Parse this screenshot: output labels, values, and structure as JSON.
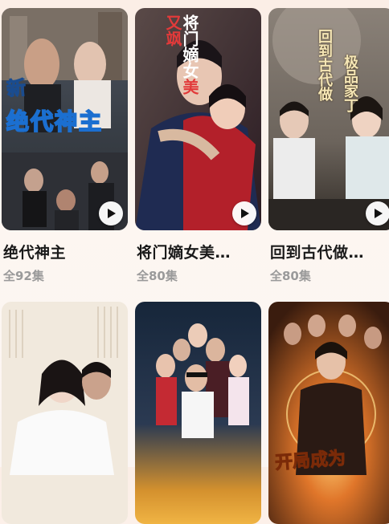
{
  "dramas": [
    {
      "title": "绝代神主",
      "episodes": "全92集",
      "poster_text_line1": "新",
      "poster_text_line2": "绝代神主",
      "poster_palette": [
        "#2b3542",
        "#5c6a7a",
        "#2f8fe0"
      ]
    },
    {
      "title": "将门嫡女美…",
      "episodes": "全80集",
      "poster_text_line1": "将门嫡女",
      "poster_text_line2": "美又飒",
      "poster_palette": [
        "#3a2530",
        "#b0212a",
        "#1f2f5a"
      ]
    },
    {
      "title": "回到古代做…",
      "episodes": "全80集",
      "poster_text_line1": "回到古代做",
      "poster_text_line2": "极品家丁",
      "poster_palette": [
        "#7d7368",
        "#d6cfc4",
        "#4a3c2c"
      ]
    },
    {
      "title": "",
      "episodes": "",
      "poster_palette": [
        "#e8dccb",
        "#f4efe6",
        "#2a2a2a"
      ]
    },
    {
      "title": "",
      "episodes": "",
      "poster_palette": [
        "#1d2b3c",
        "#c98a2e",
        "#f0b040"
      ]
    },
    {
      "title": "",
      "episodes": "",
      "poster_text_line1": "开局成为",
      "poster_palette": [
        "#3a1c0e",
        "#e0762a",
        "#f4c268"
      ]
    }
  ],
  "icons": {
    "play": "play-icon"
  },
  "colors": {
    "title_text": "#1a1a1a",
    "episode_text": "#9a9a9a",
    "background": "#fbeee6"
  }
}
